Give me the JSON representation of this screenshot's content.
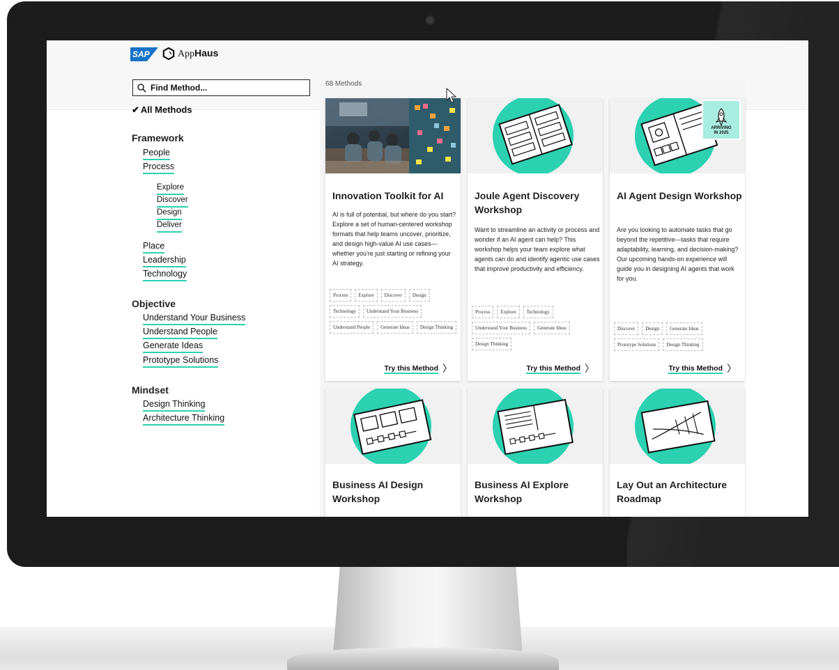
{
  "brand": {
    "sap": "SAP",
    "app_pre": "App",
    "app_bold": "Haus"
  },
  "search": {
    "placeholder": "Find Method..."
  },
  "sidebar": {
    "all": "All Methods",
    "framework": {
      "title": "Framework",
      "people": "People",
      "process": "Process",
      "explore": "Explore",
      "discover": "Discover",
      "design": "Design",
      "deliver": "Deliver",
      "place": "Place",
      "leadership": "Leadership",
      "technology": "Technology"
    },
    "objective": {
      "title": "Objective",
      "business": "Understand Your Business",
      "people": "Understand People",
      "ideas": "Generate Ideas",
      "prototype": "Prototype Solutions"
    },
    "mindset": {
      "title": "Mindset",
      "design": "Design Thinking",
      "architecture": "Architecture Thinking"
    }
  },
  "content": {
    "count": "68 Methods",
    "try_label": "Try this Method",
    "cards": [
      {
        "title": "Innovation Toolkit for AI",
        "desc": "AI is full of potential, but where do you start? Explore a set of human-centered workshop formats that help teams uncover, prioritize, and design high-value AI use cases—whether you're just starting or refining your AI strategy.",
        "tags": [
          "Process",
          "Explore",
          "Discover",
          "Design",
          "Technology",
          "Understand Your Business",
          "Understand People",
          "Generate Ideas",
          "Design Thinking"
        ]
      },
      {
        "title": "Joule Agent Discovery Workshop",
        "desc": "Want to streamline an activity or process and wonder if an AI agent can help? This workshop helps your team explore what agents can do and identify agentic use cases that improve productivity and efficiency.",
        "tags": [
          "Process",
          "Explore",
          "Technology",
          "Understand Your Business",
          "Generate Ideas",
          "Design Thinking"
        ]
      },
      {
        "title": "AI Agent Design Workshop",
        "desc": "Are you looking to automate tasks that go beyond the repetitive—tasks that require adaptability, learning, and decision-making? Our upcoming hands-on experience will guide you in designing AI agents that work for you.",
        "tags": [
          "Discover",
          "Design",
          "Generate Ideas",
          "Prototype Solutions",
          "Design Thinking"
        ],
        "badge": {
          "line1": "ARRIVING",
          "line2": "IN 2025"
        }
      },
      {
        "title": "Business AI Design Workshop"
      },
      {
        "title": "Business AI Explore Workshop"
      },
      {
        "title": "Lay Out an Architecture Roadmap"
      }
    ]
  },
  "colors": {
    "accent": "#2bd1b0",
    "sap_blue": "#1673c7",
    "bezel": "#1c1c1c"
  }
}
